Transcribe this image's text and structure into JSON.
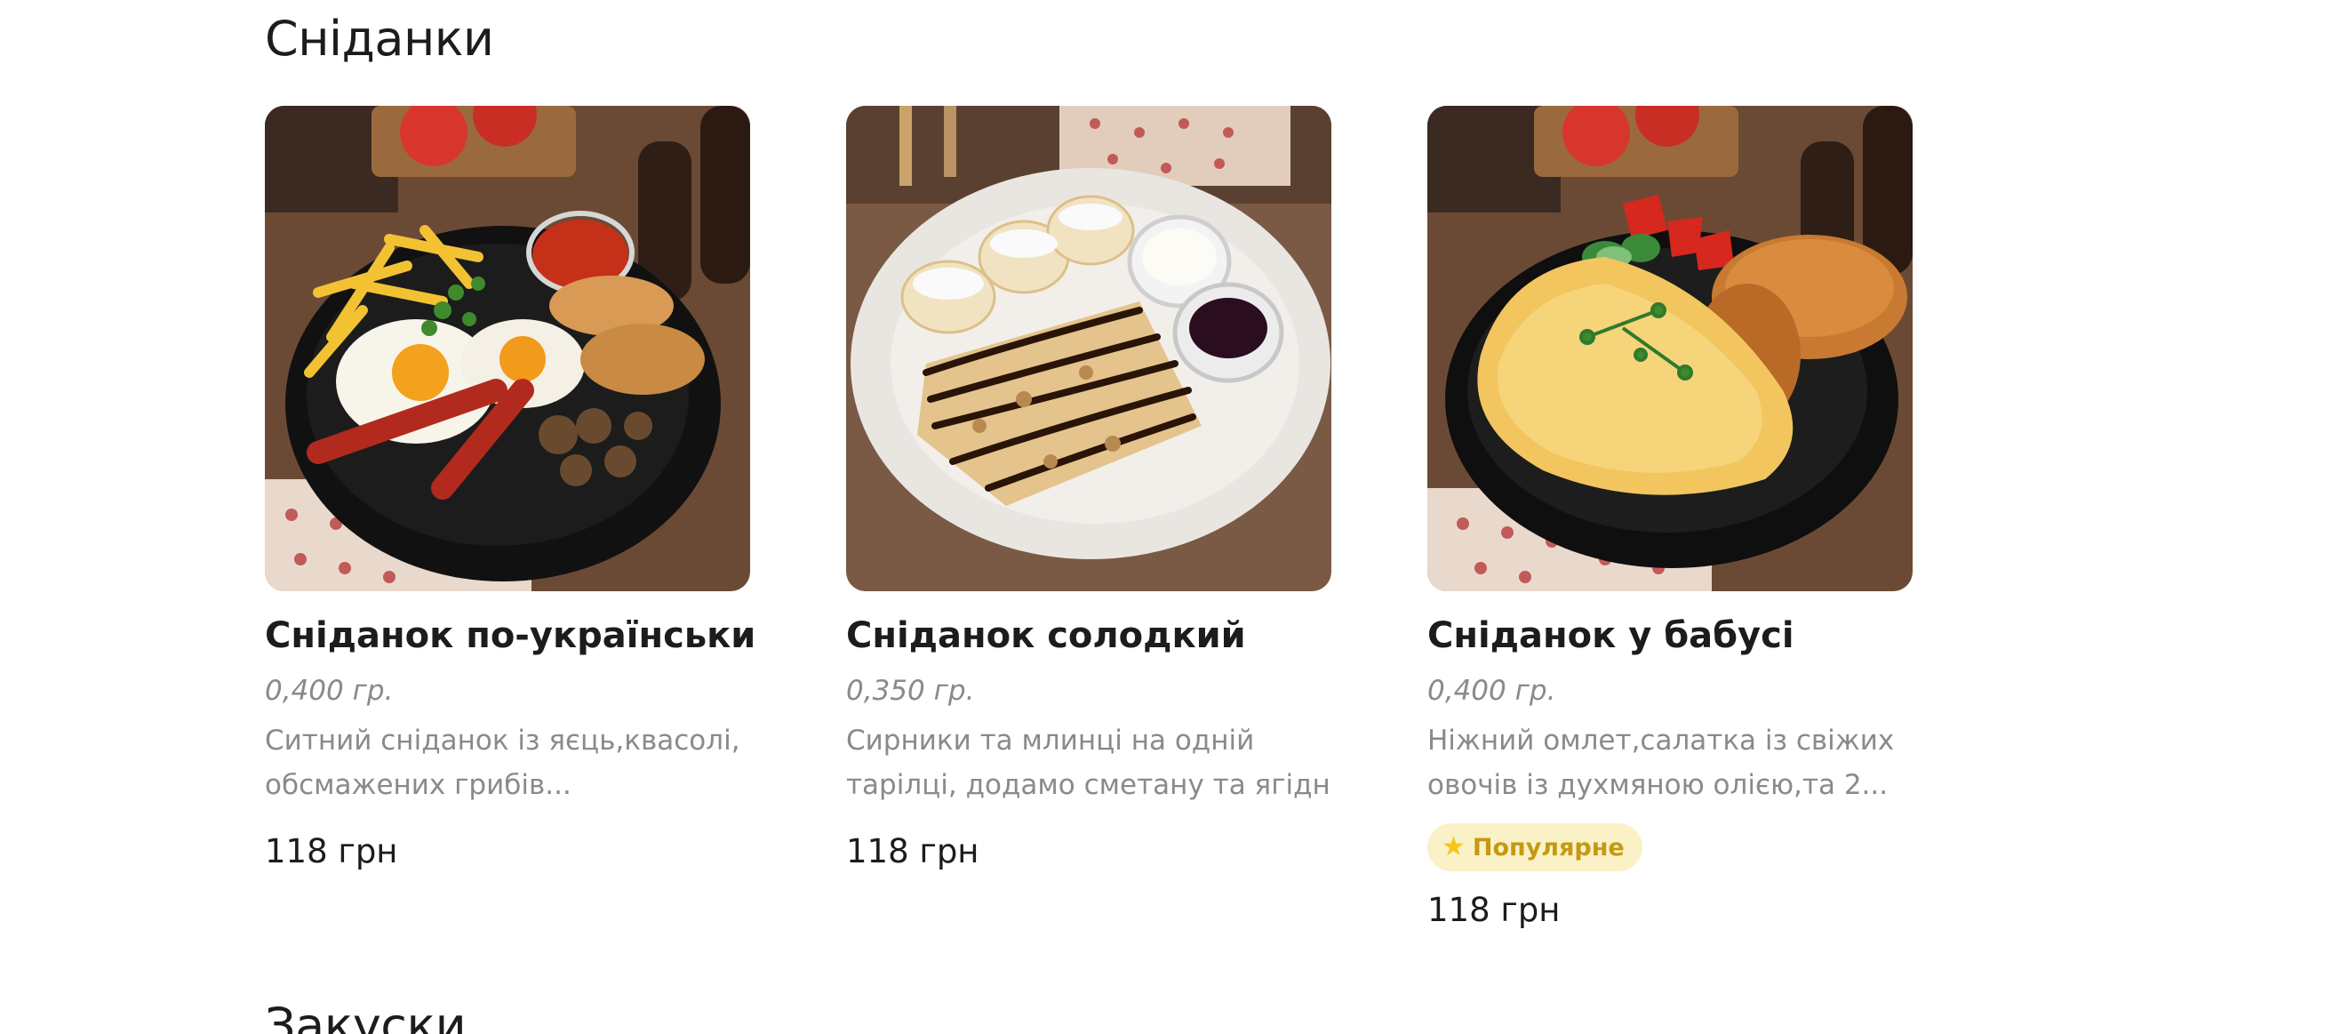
{
  "sections": [
    {
      "title": "Сніданки"
    },
    {
      "title": "Закуски"
    }
  ],
  "colors": {
    "badge_bg": "#fbf1c7",
    "badge_text": "#c49a12",
    "muted_text": "#8a8a8a"
  },
  "items": [
    {
      "name": "Сніданок по-українськи",
      "weight": "0,400 гр.",
      "desc_line1": "Ситний сніданок із яєць,квасолі,",
      "desc_line2": "обсмажених грибів...",
      "price": "118 грн",
      "image_alt": "Сніданок по-українськи"
    },
    {
      "name": "Сніданок солодкий",
      "weight": "0,350 гр.",
      "desc_line1": "Сирники та млинці на одній",
      "desc_line2": "тарілці, додамо сметану та ягідни...",
      "price": "118 грн",
      "image_alt": "Сніданок солодкий"
    },
    {
      "name": "Сніданок у бабусі",
      "weight": "0,400 гр.",
      "desc_line1": "Ніжний омлет,салатка із свіжих",
      "desc_line2": "овочів із духмяною олією,та 2...",
      "badge": "Популярне",
      "badge_icon": "star-icon",
      "price": "118 грн",
      "image_alt": "Сніданок у бабусі"
    }
  ]
}
